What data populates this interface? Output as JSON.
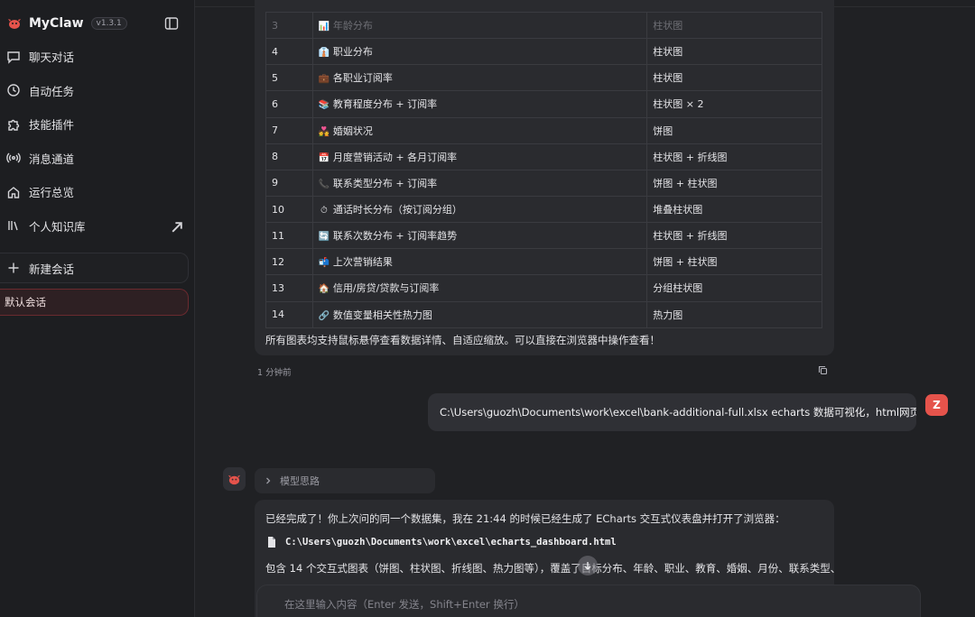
{
  "sidebar": {
    "brand_name": "MyClaw",
    "version": "v1.3.1",
    "nav": [
      {
        "label": "聊天对话",
        "icon": "chat-icon"
      },
      {
        "label": "自动任务",
        "icon": "clock-icon"
      },
      {
        "label": "技能插件",
        "icon": "puzzle-icon"
      },
      {
        "label": "消息通道",
        "icon": "broadcast-icon"
      },
      {
        "label": "运行总览",
        "icon": "home-icon"
      },
      {
        "label": "个人知识库",
        "icon": "library-icon"
      }
    ],
    "new_chat": "新建会话",
    "session": "默认会话"
  },
  "chat": {
    "table": [
      {
        "num": "3",
        "content": "年龄分布",
        "type": "柱状图",
        "icon": "📊"
      },
      {
        "num": "4",
        "content": "职业分布",
        "type": "柱状图",
        "icon": "👔"
      },
      {
        "num": "5",
        "content": "各职业订阅率",
        "type": "柱状图",
        "icon": "💼"
      },
      {
        "num": "6",
        "content": "教育程度分布 + 订阅率",
        "type": "柱状图 × 2",
        "icon": "📚"
      },
      {
        "num": "7",
        "content": "婚姻状况",
        "type": "饼图",
        "icon": "💑"
      },
      {
        "num": "8",
        "content": "月度营销活动 + 各月订阅率",
        "type": "柱状图 + 折线图",
        "icon": "📅"
      },
      {
        "num": "9",
        "content": "联系类型分布 + 订阅率",
        "type": "饼图 + 柱状图",
        "icon": "📞"
      },
      {
        "num": "10",
        "content": "通话时长分布（按订阅分组）",
        "type": "堆叠柱状图",
        "icon": "⏱"
      },
      {
        "num": "11",
        "content": "联系次数分布 + 订阅率趋势",
        "type": "柱状图 + 折线图",
        "icon": "🔄"
      },
      {
        "num": "12",
        "content": "上次营销结果",
        "type": "饼图 + 柱状图",
        "icon": "📬"
      },
      {
        "num": "13",
        "content": "信用/房贷/贷款与订阅率",
        "type": "分组柱状图",
        "icon": "🏠"
      },
      {
        "num": "14",
        "content": "数值变量相关性热力图",
        "type": "热力图",
        "icon": "🔗"
      }
    ],
    "table_note": "所有图表均支持鼠标悬停查看数据详情、自适应缩放。可以直接在浏览器中操作查看！",
    "message_time": "1 分钟前",
    "user_message": "C:\\Users\\guozh\\Documents\\work\\excel\\bank-additional-full.xlsx echarts 数据可视化，html网页展示",
    "user_avatar_letter": "Z",
    "thinking_label": "模型思路",
    "reply_intro": "已经完成了！你上次问的同一个数据集，我在 21:44 的时候已经生成了 ECharts 交互式仪表盘并打开了浏览器：",
    "reply_path": "C:\\Users\\guozh\\Documents\\work\\excel\\echarts_dashboard.html",
    "reply_summary": "包含 14 个交互式图表（饼图、柱状图、折线图、热力图等），覆盖了目标分布、年龄、职业、教育、婚姻、月份、联系类型、"
  },
  "input": {
    "placeholder": "在这里输入内容（Enter 发送，Shift+Enter 换行）"
  },
  "colors": {
    "accent": "#e5534b",
    "session_border": "#6b2a2f"
  }
}
